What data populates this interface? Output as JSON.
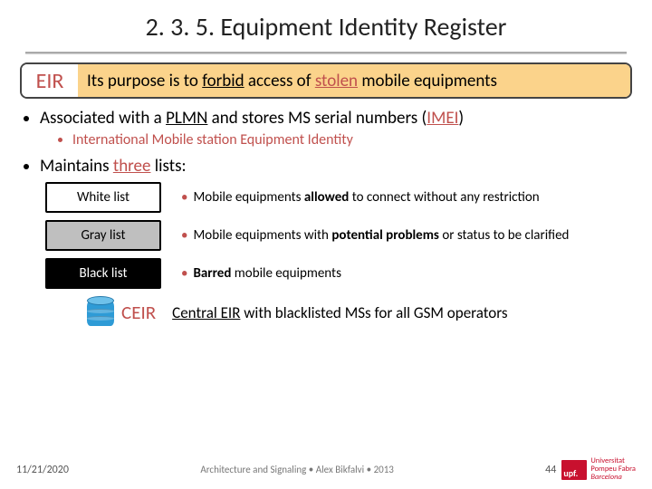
{
  "title": "2. 3. 5. Equipment Identity Register",
  "purpose": {
    "badge": "EIR",
    "pre": "Its purpose is to ",
    "forbid": "forbid",
    "mid": " access of ",
    "stolen": "stolen",
    "post": " mobile equipments"
  },
  "bullet1": {
    "pre": "Associated with a ",
    "plmn": "PLMN",
    "mid": " and stores MS serial numbers (",
    "imei": "IMEI",
    "post": ")"
  },
  "subbullet1": "International Mobile station Equipment Identity",
  "bullet2": {
    "pre": "Maintains ",
    "three": "three",
    "post": " lists:"
  },
  "lists": [
    {
      "name": "White list",
      "style": "white",
      "desc_pre": "Mobile equipments ",
      "desc_bold": "allowed",
      "desc_post": " to connect without any restriction"
    },
    {
      "name": "Gray list",
      "style": "gray",
      "desc_pre": "Mobile equipments with ",
      "desc_bold": "potential problems",
      "desc_post": " or status to be clarified"
    },
    {
      "name": "Black list",
      "style": "black",
      "desc_pre": "",
      "desc_bold": "Barred",
      "desc_post": " mobile equipments"
    }
  ],
  "ceir": {
    "label": "CEIR",
    "text_pre": "Central EIR",
    "text_post": " with blacklisted MSs for all GSM operators"
  },
  "footer": {
    "date": "11/21/2020",
    "center": "Architecture and Signaling • Alex Bikfalvi • 2013",
    "page": "44",
    "logo_mark": "upf.",
    "logo_line1": "Universitat",
    "logo_line2": "Pompeu Fabra",
    "logo_line3": "Barcelona"
  }
}
